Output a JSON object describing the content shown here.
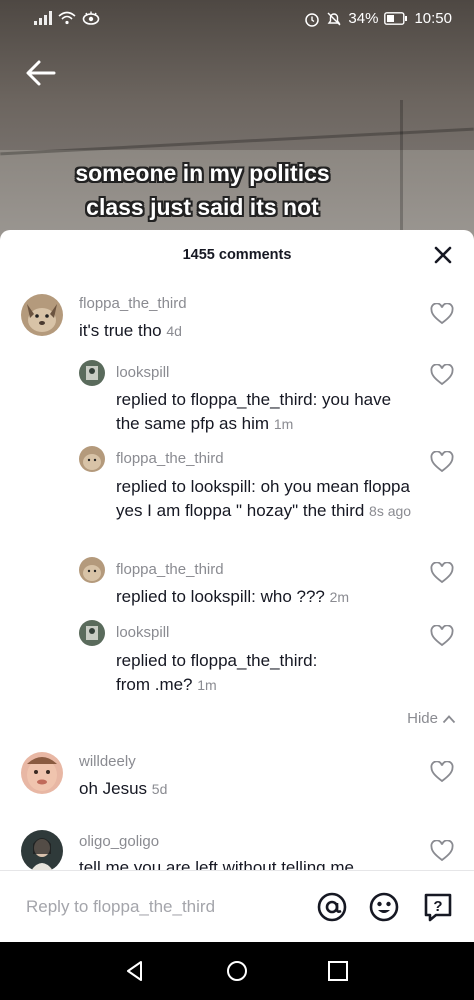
{
  "status": {
    "battery_percent": "34%",
    "time": "10:50"
  },
  "video": {
    "caption_line1": "someone in my politics",
    "caption_line2": "class just said its not"
  },
  "comments_sheet": {
    "count_label": "1455 comments",
    "hide_label": "Hide",
    "comments": [
      {
        "user": "floppa_the_third",
        "text": "it's true tho",
        "time": "4d"
      },
      {
        "user": "lookspill",
        "prefix": "replied to ",
        "target": "floppa_the_third",
        "text": ": you have the same pfp as him",
        "time": "1m"
      },
      {
        "user": "floppa_the_third",
        "prefix": "replied to ",
        "target": "lookspill",
        "text": ": oh you mean floppa yes I am floppa \" hozay\" the third",
        "time": "8s ago"
      },
      {
        "user": "floppa_the_third",
        "prefix": "replied to ",
        "target": "lookspill",
        "text": ": who ???",
        "time": "2m"
      },
      {
        "user": "lookspill",
        "prefix": "replied to ",
        "target": "floppa_the_third",
        "text": ":",
        "text2": "from .me?",
        "time": "1m"
      },
      {
        "user": "willdeely",
        "text": "oh Jesus",
        "time": "5d"
      },
      {
        "user": "oligo_goligo",
        "text": "tell me you are left without telling me"
      }
    ]
  },
  "reply_bar": {
    "placeholder": "Reply to floppa_the_third"
  },
  "icons": [
    "back-arrow-icon",
    "close-icon",
    "heart-icon",
    "at-icon",
    "emoji-icon",
    "question-icon",
    "chevron-up-icon"
  ]
}
